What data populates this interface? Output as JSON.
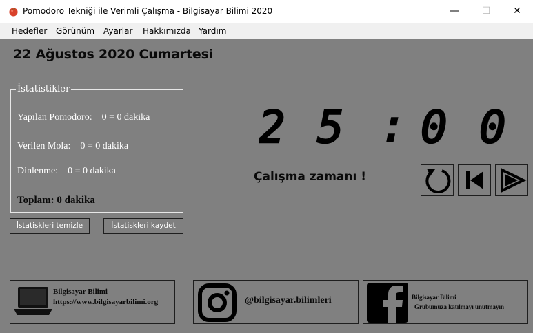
{
  "window": {
    "title": "Pomodoro Tekniği ile Verimli Çalışma - Bilgisayar Bilimi 2020",
    "minimize": "—",
    "maximize": "☐",
    "close": "✕"
  },
  "menu": [
    "Hedefler",
    "Görünüm",
    "Ayarlar",
    "Hakkımızda",
    "Yardım"
  ],
  "date": "22 Ağustos 2020 Cumartesi",
  "stats": {
    "legend": "İstatistikler",
    "rows": [
      {
        "label": "Yapılan Pomodoro:",
        "value": "0 = 0 dakika"
      },
      {
        "label": "Verilen Mola:",
        "value": "0 = 0 dakika"
      },
      {
        "label": "Dinlenme:",
        "value": "0 = 0 dakika"
      }
    ],
    "total": "Toplam: 0 dakika",
    "clear_button": "İstatiskleri temizle",
    "save_button": "İstatiskleri kaydet"
  },
  "timer": {
    "digits": [
      "2",
      "5",
      ":",
      "0",
      "0"
    ],
    "status": "Çalışma zamanı !"
  },
  "controls": {
    "icons": [
      "refresh-icon",
      "skip-back-icon",
      "play-icon"
    ]
  },
  "footer": {
    "website": {
      "name": "Bilgisayar Bilimi",
      "url": "https://www.bilgisayarbilimi.org"
    },
    "instagram": {
      "handle": "@bilgisayar.bilimleri"
    },
    "facebook": {
      "name": "Bilgisayar Bilimi",
      "message": "Grubumuza katılmayı unutmayın"
    }
  },
  "colors": {
    "background": "#808080",
    "menubar": "#f0f0f0",
    "titlebar": "#ffffff",
    "text_dark": "#0a0a0a",
    "text_light": "#ffffff"
  }
}
